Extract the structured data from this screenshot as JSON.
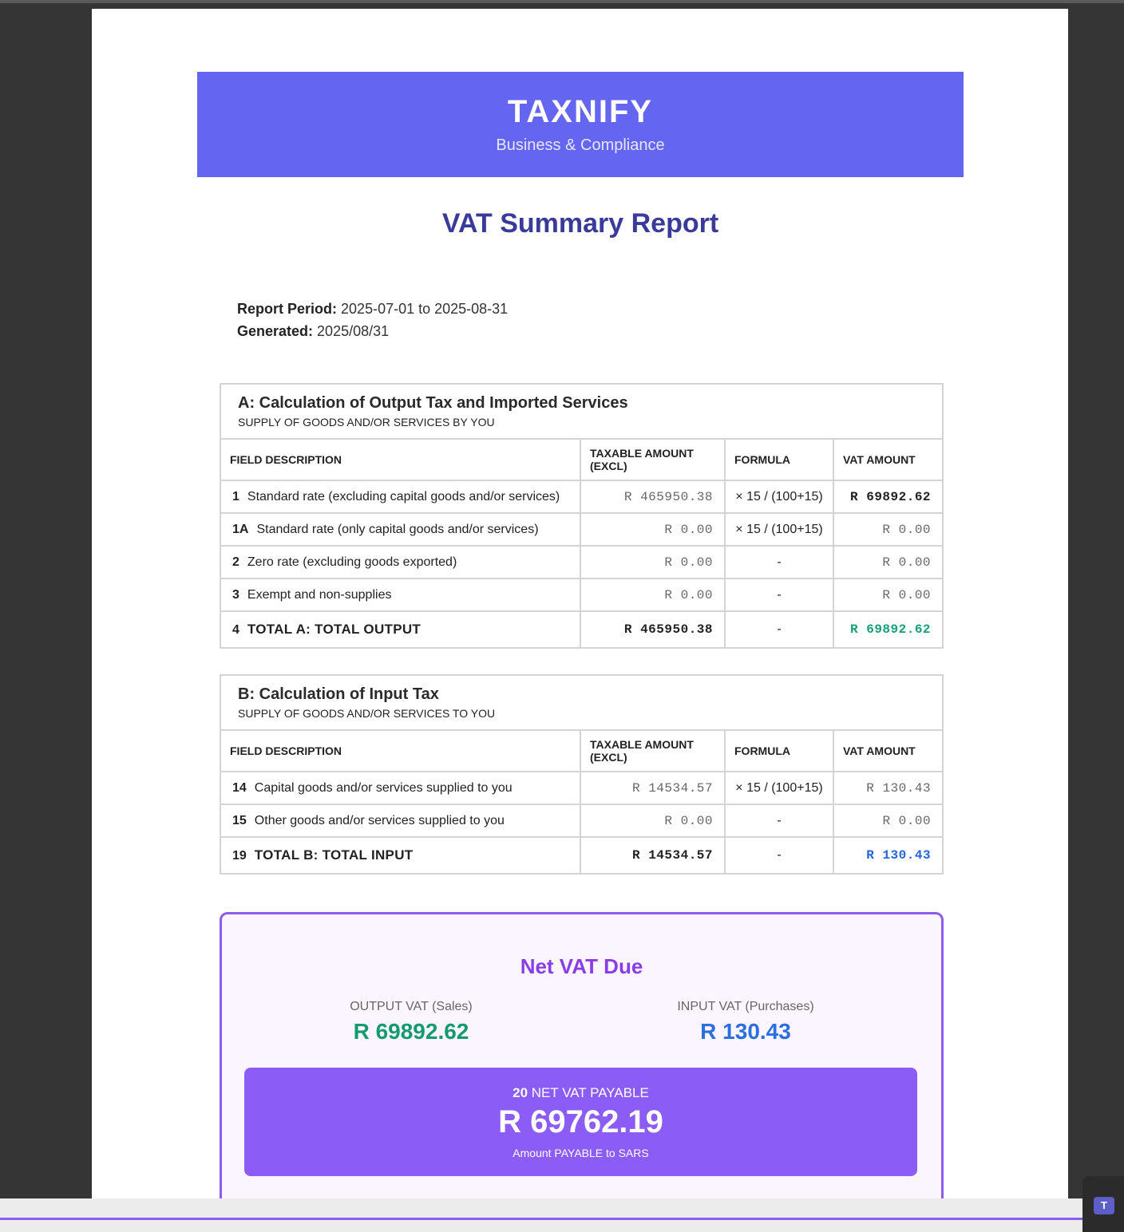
{
  "brand": {
    "name": "TAXNIFY",
    "tagline": "Business & Compliance"
  },
  "report": {
    "title": "VAT Summary Report",
    "period_label": "Report Period:",
    "period_value": "2025-07-01 to 2025-08-31",
    "generated_label": "Generated:",
    "generated_value": "2025/08/31"
  },
  "table_headers": {
    "field_description": "FIELD DESCRIPTION",
    "taxable_amount": "TAXABLE AMOUNT (EXCL)",
    "formula": "FORMULA",
    "vat_amount": "VAT AMOUNT"
  },
  "section_a": {
    "title": "A: Calculation of Output Tax and Imported Services",
    "subtitle": "SUPPLY OF GOODS AND/OR SERVICES BY YOU",
    "rows": [
      {
        "num": "1",
        "label": "Standard rate (excluding capital goods and/or services)",
        "taxable": "R 465950.38",
        "formula": "× 15 / (100+15)",
        "vat": "R 69892.62"
      },
      {
        "num": "1A",
        "label": "Standard rate (only capital goods and/or services)",
        "taxable": "R 0.00",
        "formula": "× 15 / (100+15)",
        "vat": "R 0.00"
      },
      {
        "num": "2",
        "label": "Zero rate (excluding goods exported)",
        "taxable": "R 0.00",
        "formula": "-",
        "vat": "R 0.00"
      },
      {
        "num": "3",
        "label": "Exempt and non-supplies",
        "taxable": "R 0.00",
        "formula": "-",
        "vat": "R 0.00"
      }
    ],
    "total": {
      "num": "4",
      "label": "TOTAL A: TOTAL OUTPUT",
      "taxable": "R 465950.38",
      "formula": "-",
      "vat": "R 69892.62"
    }
  },
  "section_b": {
    "title": "B: Calculation of Input Tax",
    "subtitle": "SUPPLY OF GOODS AND/OR SERVICES TO YOU",
    "rows": [
      {
        "num": "14",
        "label": "Capital goods and/or services supplied to you",
        "taxable": "R 14534.57",
        "formula": "× 15 / (100+15)",
        "vat": "R 130.43"
      },
      {
        "num": "15",
        "label": "Other goods and/or services supplied to you",
        "taxable": "R 0.00",
        "formula": "-",
        "vat": "R 0.00"
      }
    ],
    "total": {
      "num": "19",
      "label": "TOTAL B: TOTAL INPUT",
      "taxable": "R 14534.57",
      "formula": "-",
      "vat": "R 130.43"
    }
  },
  "net_vat": {
    "title": "Net VAT Due",
    "output_label": "OUTPUT VAT (Sales)",
    "output_value": "R 69892.62",
    "input_label": "INPUT VAT (Purchases)",
    "input_value": "R 130.43",
    "payable_num": "20",
    "payable_label": "NET VAT PAYABLE",
    "payable_value": "R 69762.19",
    "payable_note": "Amount PAYABLE to SARS"
  },
  "taskbar": {
    "app_icon": "teams-icon",
    "app_letter": "T"
  },
  "colors": {
    "brand": "#6466f1",
    "title": "#3a3a9a",
    "output_green": "#16a07a",
    "input_blue": "#2466d8",
    "net_purple": "#8b5cf6"
  }
}
